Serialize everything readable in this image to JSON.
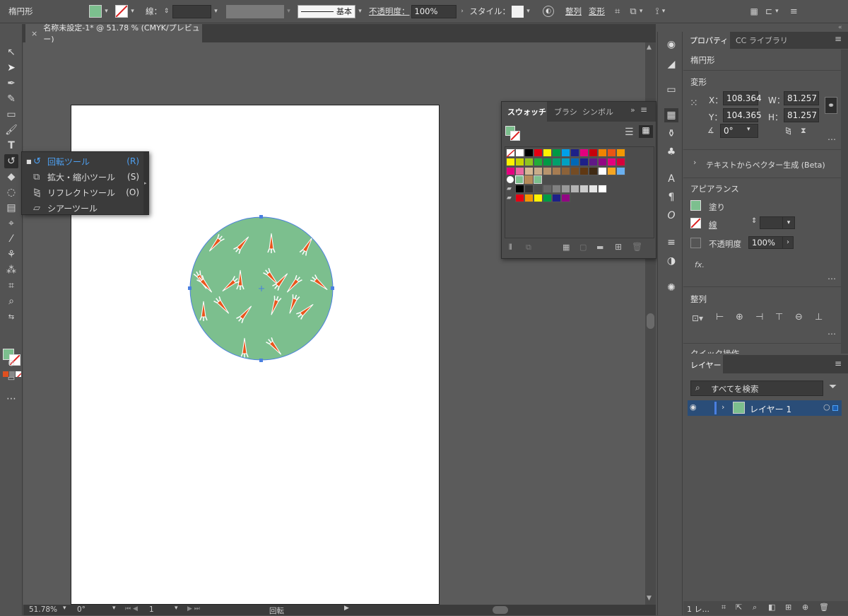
{
  "control_bar": {
    "object_type": "楕円形",
    "stroke_label": "線：",
    "stroke_style": "基本",
    "opacity_label": "不透明度：",
    "opacity_value": "100%",
    "style_label": "スタイル：",
    "align_label": "整列",
    "transform_label": "変形",
    "fill_color": "#7cbf8e",
    "stroke_none_color": "#d22"
  },
  "document_tab": {
    "close": "×",
    "title": "名称未設定-1* @ 51.78 % (CMYK/プレビュー)"
  },
  "flyout": {
    "items": [
      {
        "label": "回転ツール",
        "key": "(R)",
        "active": true
      },
      {
        "label": "拡大・縮小ツール",
        "key": "(S)"
      },
      {
        "label": "リフレクトツール",
        "key": "(O)"
      },
      {
        "label": "シアーツール",
        "key": ""
      }
    ]
  },
  "swatches": {
    "tabs": [
      "スウォッチ",
      "ブラシ",
      "シンボル"
    ],
    "row1": [
      "#fff",
      "#fff",
      "#000",
      "#e60012",
      "#fff100",
      "#009944",
      "#00a0e9",
      "#1d2088",
      "#e4007f",
      "#c7000b",
      "#f08300",
      "#ea5514",
      "#f39800"
    ],
    "row2": [
      "#fff100",
      "#c7d300",
      "#8fc31f",
      "#22ac38",
      "#009944",
      "#00a06b",
      "#00a0c1",
      "#0068b7",
      "#1d2088",
      "#601986",
      "#920783",
      "#e4007f",
      "#d7003a"
    ],
    "row3": [
      "#e4007f",
      "#ea68a2",
      "#d5b893",
      "#c9ac8a",
      "#b8946d",
      "#a67c52",
      "#8c6239",
      "#754c24",
      "#603813",
      "#3f2a14",
      "#ffffff",
      "#f5a623",
      "#6ab0f0"
    ],
    "gray_row": [
      "#000",
      "#333",
      "#4d4d4d",
      "#666",
      "#808080",
      "#999",
      "#b3b3b3",
      "#ccc",
      "#e6e6e6",
      "#fff"
    ],
    "bright_row": [
      "#e60012",
      "#f39800",
      "#fff100",
      "#009944",
      "#1d2088",
      "#920783"
    ]
  },
  "right_panel": {
    "tabs": [
      "プロパティ",
      "CC ライブラリ"
    ],
    "object_type": "楕円形",
    "transform_title": "変形",
    "x_label": "X：",
    "x_value": "108.364",
    "y_label": "Y：",
    "y_value": "104.365",
    "w_label": "W：",
    "w_value": "81.257",
    "h_label": "H：",
    "h_value": "81.257",
    "angle_value": "0°",
    "vector_gen": "テキストからベクター生成 (Beta)",
    "appearance_title": "アピアランス",
    "fill_label": "塗り",
    "stroke_label": "線",
    "opacity_label": "不透明度",
    "opacity_value": "100%",
    "fx_label": "fx.",
    "align_title": "整列",
    "quick_actions": "クイック操作"
  },
  "layers": {
    "tab": "レイヤー",
    "search_placeholder": "すべてを検索",
    "layer_name": "レイヤー 1",
    "footer_count": "1 レ..."
  },
  "status_bar": {
    "zoom": "51.78%",
    "angle": "0°",
    "artboard": "1",
    "tool": "回転"
  }
}
